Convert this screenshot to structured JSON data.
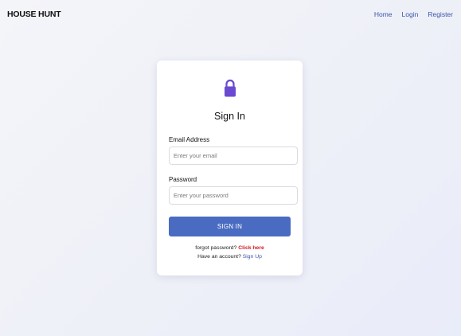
{
  "nav": {
    "brand": "HOUSE HUNT",
    "links": [
      "Home",
      "Login",
      "Register"
    ]
  },
  "signin": {
    "title": "Sign In",
    "email_label": "Email Address",
    "email_placeholder": "Enter your email",
    "email_value": "",
    "password_label": "Password",
    "password_placeholder": "Enter your password",
    "password_value": "",
    "button_label": "SIGN IN",
    "forgot_text": "forgot password?",
    "forgot_link": "Click here",
    "account_text": "Have an account?",
    "signup_link": "Sign Up"
  },
  "icons": {
    "lock": "lock-icon"
  },
  "colors": {
    "accent": "#4a6bc2",
    "lock": "#6a4ad1",
    "link_red": "#d8161d",
    "nav_link": "#3a55a8"
  }
}
